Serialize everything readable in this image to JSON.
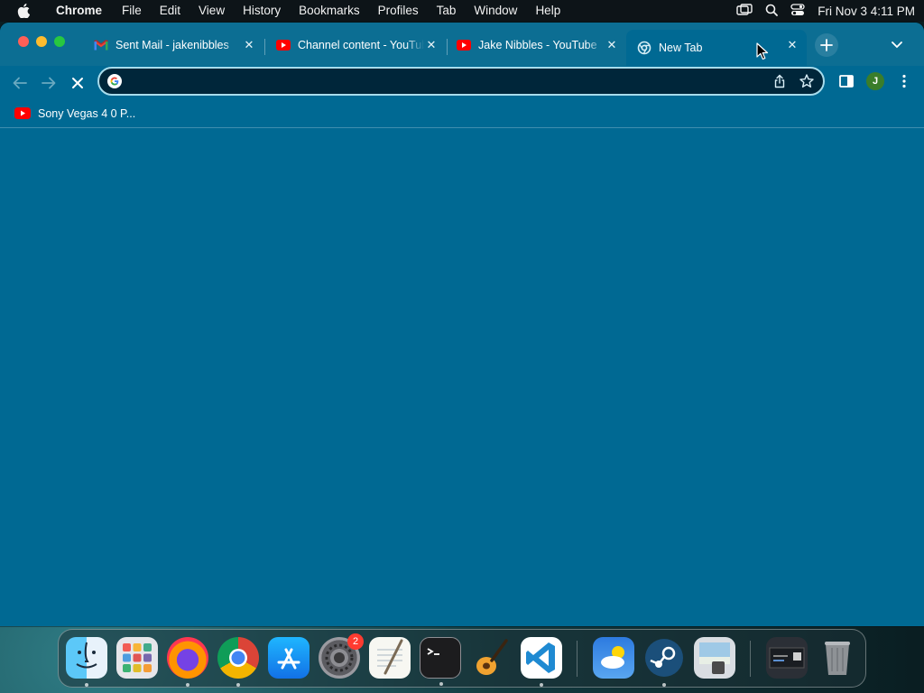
{
  "menubar": {
    "app_name": "Chrome",
    "items": [
      "File",
      "Edit",
      "View",
      "History",
      "Bookmarks",
      "Profiles",
      "Tab",
      "Window",
      "Help"
    ],
    "clock": "Fri Nov 3  4:11 PM"
  },
  "tabs": [
    {
      "title": "Sent Mail - jakenibbles",
      "favicon": "gmail-icon",
      "active": false
    },
    {
      "title": "Channel content - YouTube",
      "favicon": "youtube-icon",
      "active": false
    },
    {
      "title": "Jake Nibbles - YouTube",
      "favicon": "youtube-icon",
      "active": false
    },
    {
      "title": "New Tab",
      "favicon": "chrome-newtab-icon",
      "active": true
    }
  ],
  "omnibox": {
    "value": "",
    "placeholder": ""
  },
  "profile": {
    "initial": "J"
  },
  "bookmarks": [
    {
      "label": "Sony Vegas 4 0 P...",
      "favicon": "youtube-icon"
    }
  ],
  "dock": {
    "apps": [
      "Finder",
      "Launchpad",
      "Firefox",
      "Google Chrome",
      "App Store",
      "System Settings",
      "TextEdit",
      "Terminal",
      "GarageBand",
      "Visual Studio Code",
      "Weather",
      "Steam",
      "Preview",
      "Screenshot",
      "Trash"
    ],
    "system_settings_badge": "2"
  },
  "colors": {
    "window": "#006993",
    "tabstrip": "#0c6e93",
    "omnibox": "#00263a",
    "accent": "#a8dcec"
  }
}
